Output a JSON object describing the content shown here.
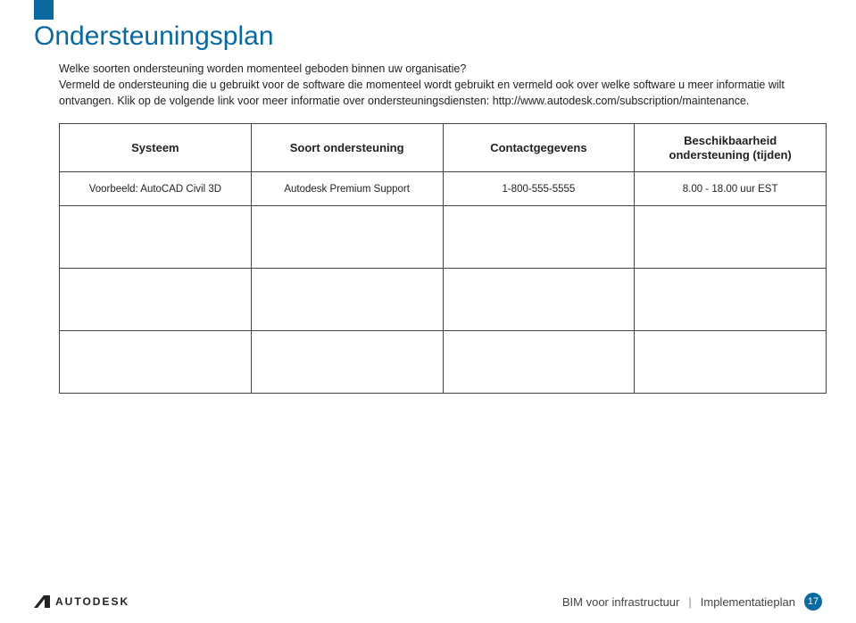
{
  "header": {
    "title": "Ondersteuningsplan"
  },
  "intro": {
    "line1": "Welke soorten ondersteuning worden momenteel geboden binnen uw organisatie?",
    "line2": "Vermeld de ondersteuning die u gebruikt voor de software die momenteel wordt gebruikt en vermeld ook over welke software u meer informatie wilt ontvangen. Klik op de volgende link voor meer informatie over ondersteuningsdiensten:",
    "link": "http://www.autodesk.com/subscription/maintenance."
  },
  "table": {
    "headers": {
      "col1": "Systeem",
      "col2": "Soort ondersteuning",
      "col3": "Contactgegevens",
      "col4_line1": "Beschikbaarheid",
      "col4_line2": "ondersteuning (tijden)"
    },
    "rows": [
      {
        "c1": "Voorbeeld: AutoCAD Civil 3D",
        "c2": "Autodesk Premium Support",
        "c3": "1-800-555-5555",
        "c4": "8.00 - 18.00 uur EST"
      },
      {
        "c1": "",
        "c2": "",
        "c3": "",
        "c4": ""
      },
      {
        "c1": "",
        "c2": "",
        "c3": "",
        "c4": ""
      },
      {
        "c1": "",
        "c2": "",
        "c3": "",
        "c4": ""
      }
    ]
  },
  "footer": {
    "logo": "AUTODESK",
    "text1": "BIM voor infrastructuur",
    "text2": "Implementatieplan",
    "page_number": "17"
  }
}
